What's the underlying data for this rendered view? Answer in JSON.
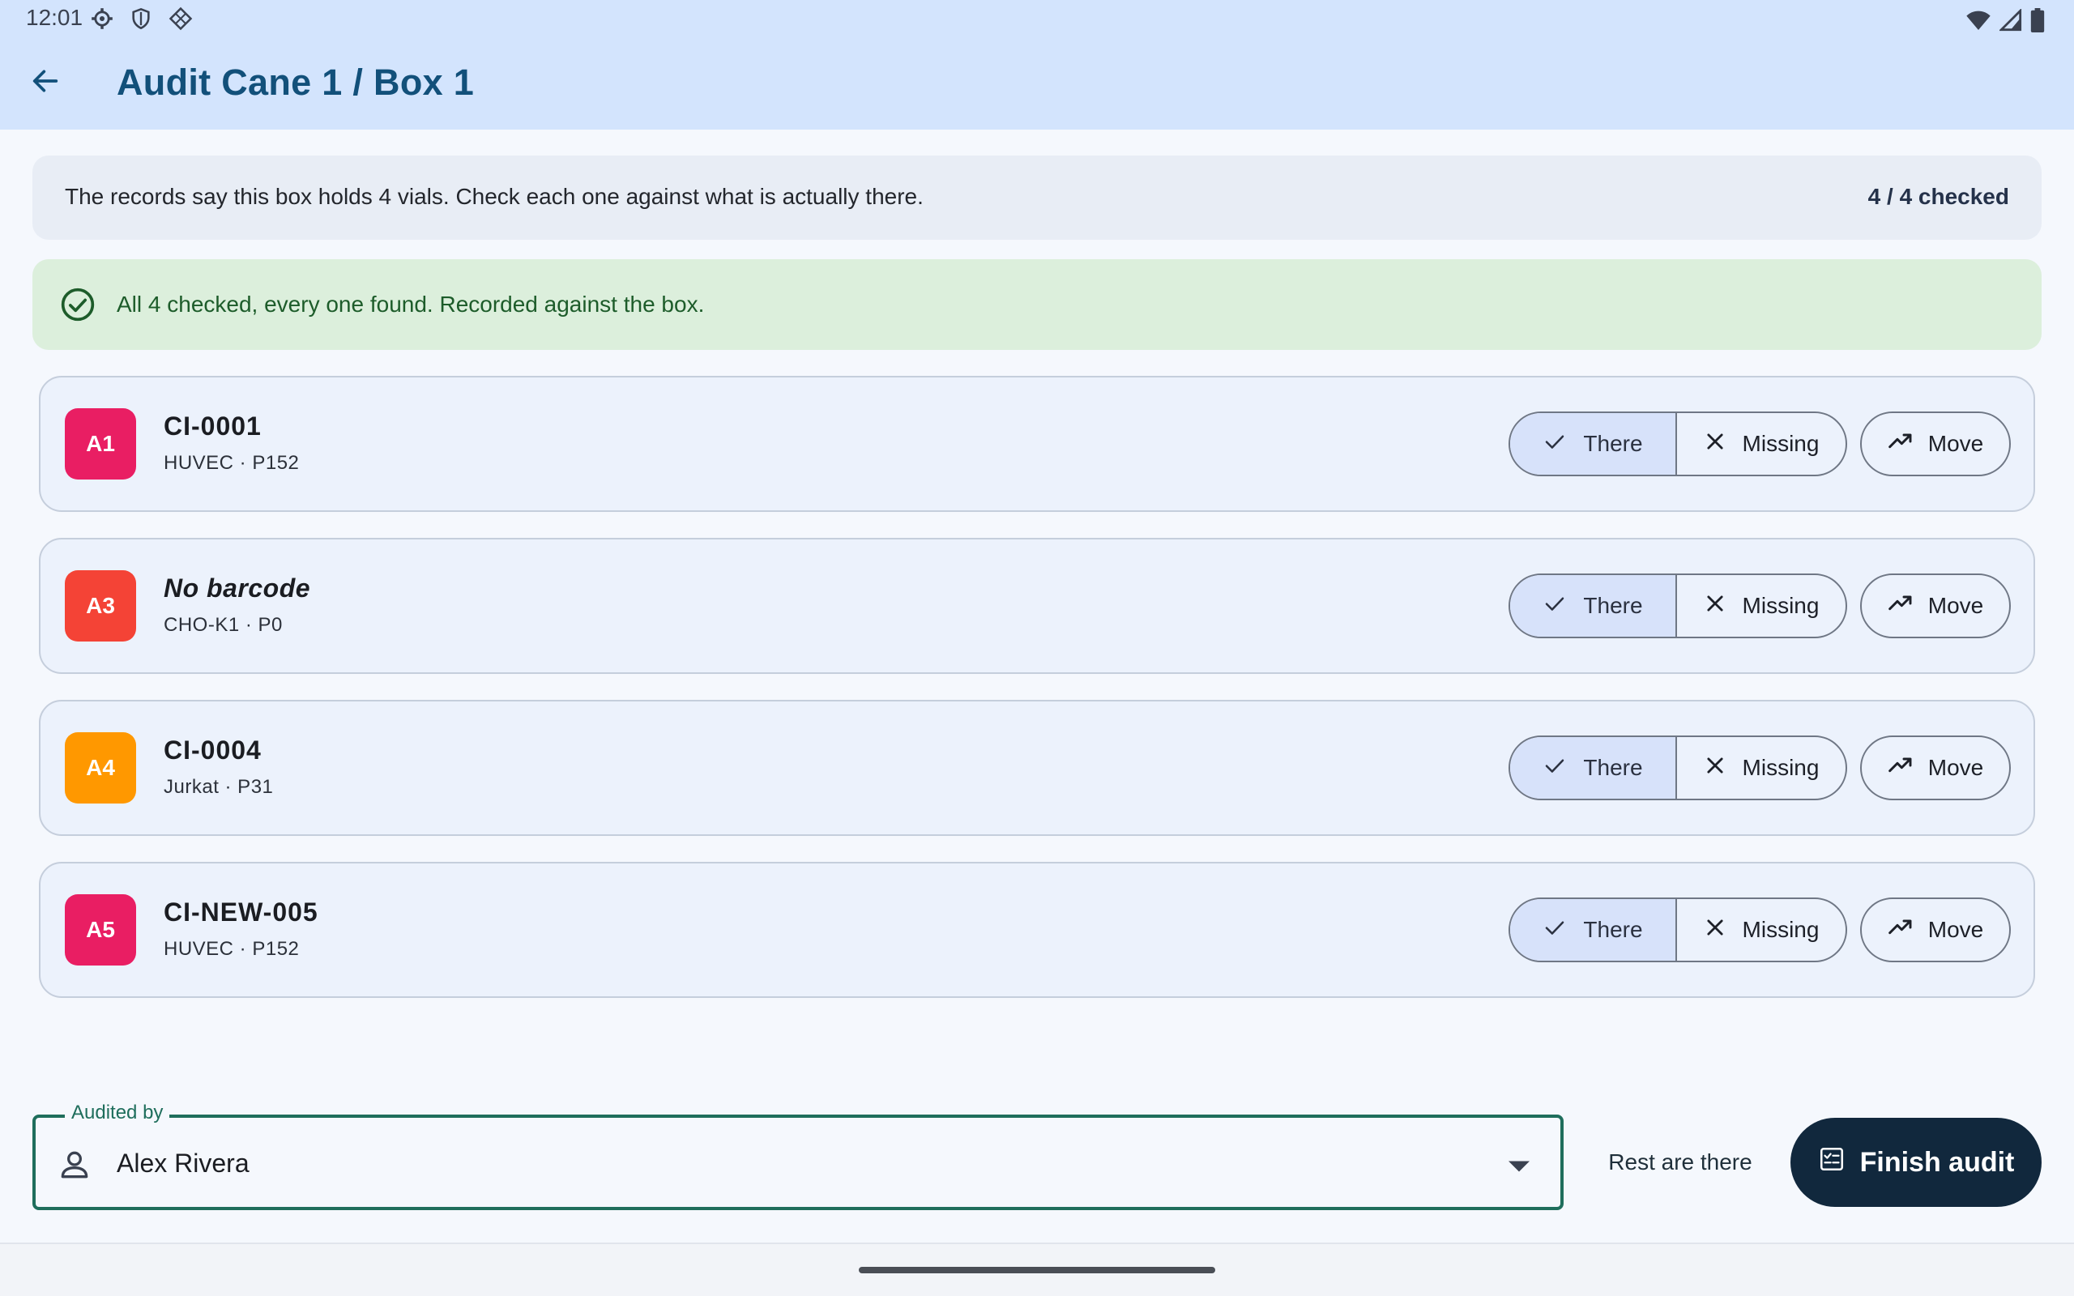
{
  "status_bar": {
    "time": "12:01",
    "left_icons": [
      "settings-icon",
      "shield-icon",
      "diamond-grid-icon"
    ],
    "right_icons": [
      "wifi-icon",
      "signal-icon",
      "battery-icon"
    ]
  },
  "header": {
    "title": "Audit Cane 1 / Box 1",
    "back_icon": "arrow-back-icon"
  },
  "summary": {
    "text": "The records say this box holds 4 vials. Check each one against what is actually there.",
    "count": "4 / 4 checked"
  },
  "banner": {
    "text": "All 4 checked, every one found. Recorded against the box.",
    "icon": "check-circle-icon"
  },
  "vials": [
    {
      "position": "A1",
      "code": "CI-0001",
      "detail": "HUVEC · P152",
      "badge_color": "#e91e63",
      "status": "There"
    },
    {
      "position": "A3",
      "code": "No barcode",
      "detail": "CHO-K1 · P0",
      "badge_color": "#f44336",
      "status": "There"
    },
    {
      "position": "A4",
      "code": "CI-0004",
      "detail": "Jurkat · P31",
      "badge_color": "#ff9800",
      "status": "There"
    },
    {
      "position": "A5",
      "code": "CI-NEW-005",
      "detail": "HUVEC · P152",
      "badge_color": "#e91e63",
      "status": "There"
    }
  ],
  "actions": {
    "there_label": "There",
    "missing_label": "Missing",
    "move_label": "Move"
  },
  "audited_by": {
    "label": "Audited by",
    "value": "Alex Rivera"
  },
  "footer": {
    "rest_label": "Rest are there",
    "finish_label": "Finish audit"
  },
  "colors": {
    "app_bar": "#d3e4fd",
    "title": "#12507a",
    "success_bg": "#dcefdc",
    "success_text": "#1d5c2a",
    "selected_segment": "#d7e2fa",
    "finish_button": "#11283d",
    "field_border": "#1f6e5c"
  }
}
